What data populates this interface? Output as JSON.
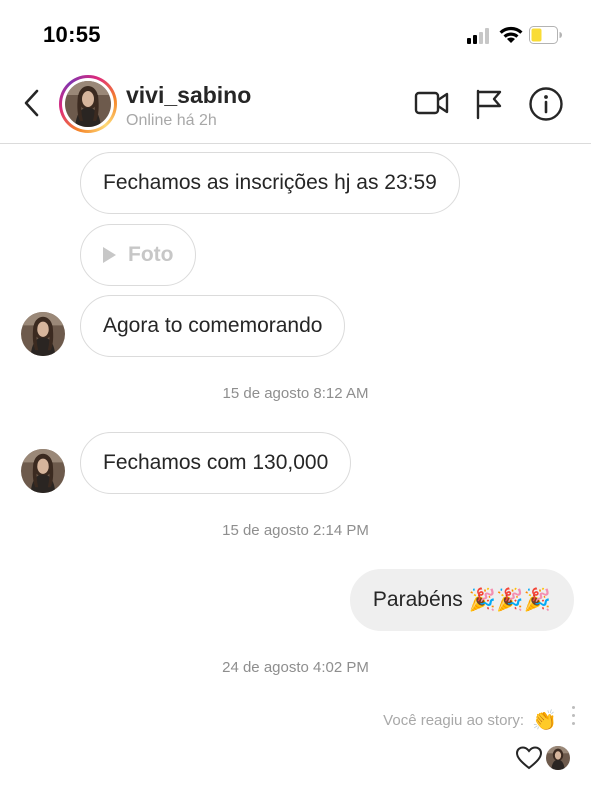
{
  "status_bar": {
    "time": "10:55"
  },
  "header": {
    "username": "vivi_sabino",
    "status": "Online há 2h",
    "icons": [
      "back-arrow-icon",
      "video-call-icon",
      "flag-icon",
      "info-icon"
    ]
  },
  "messages": [
    {
      "direction": "incoming",
      "type": "text",
      "text": "Fechamos as inscrições hj as 23:59"
    },
    {
      "direction": "incoming",
      "type": "media",
      "text": "Foto"
    },
    {
      "direction": "incoming",
      "type": "text",
      "text": "Agora to comemorando"
    },
    {
      "type": "timestamp",
      "text": "15 de agosto 8:12 AM"
    },
    {
      "direction": "incoming",
      "type": "text",
      "text": "Fechamos com 130,000"
    },
    {
      "type": "timestamp",
      "text": "15 de agosto 2:14 PM"
    },
    {
      "direction": "outgoing",
      "type": "text",
      "text": "Parabéns",
      "emoji": "🎉🎉🎉"
    },
    {
      "type": "timestamp",
      "text": "24 de agosto 4:02 PM"
    }
  ],
  "story_reaction": {
    "text": "Você reagiu ao story:",
    "emoji": "👏"
  },
  "colors": {
    "bubble_border": "#dbdbdb",
    "outgoing_bubble": "#efefef",
    "secondary_text": "#8e8e8e",
    "battery_low": "#f9dc35"
  }
}
